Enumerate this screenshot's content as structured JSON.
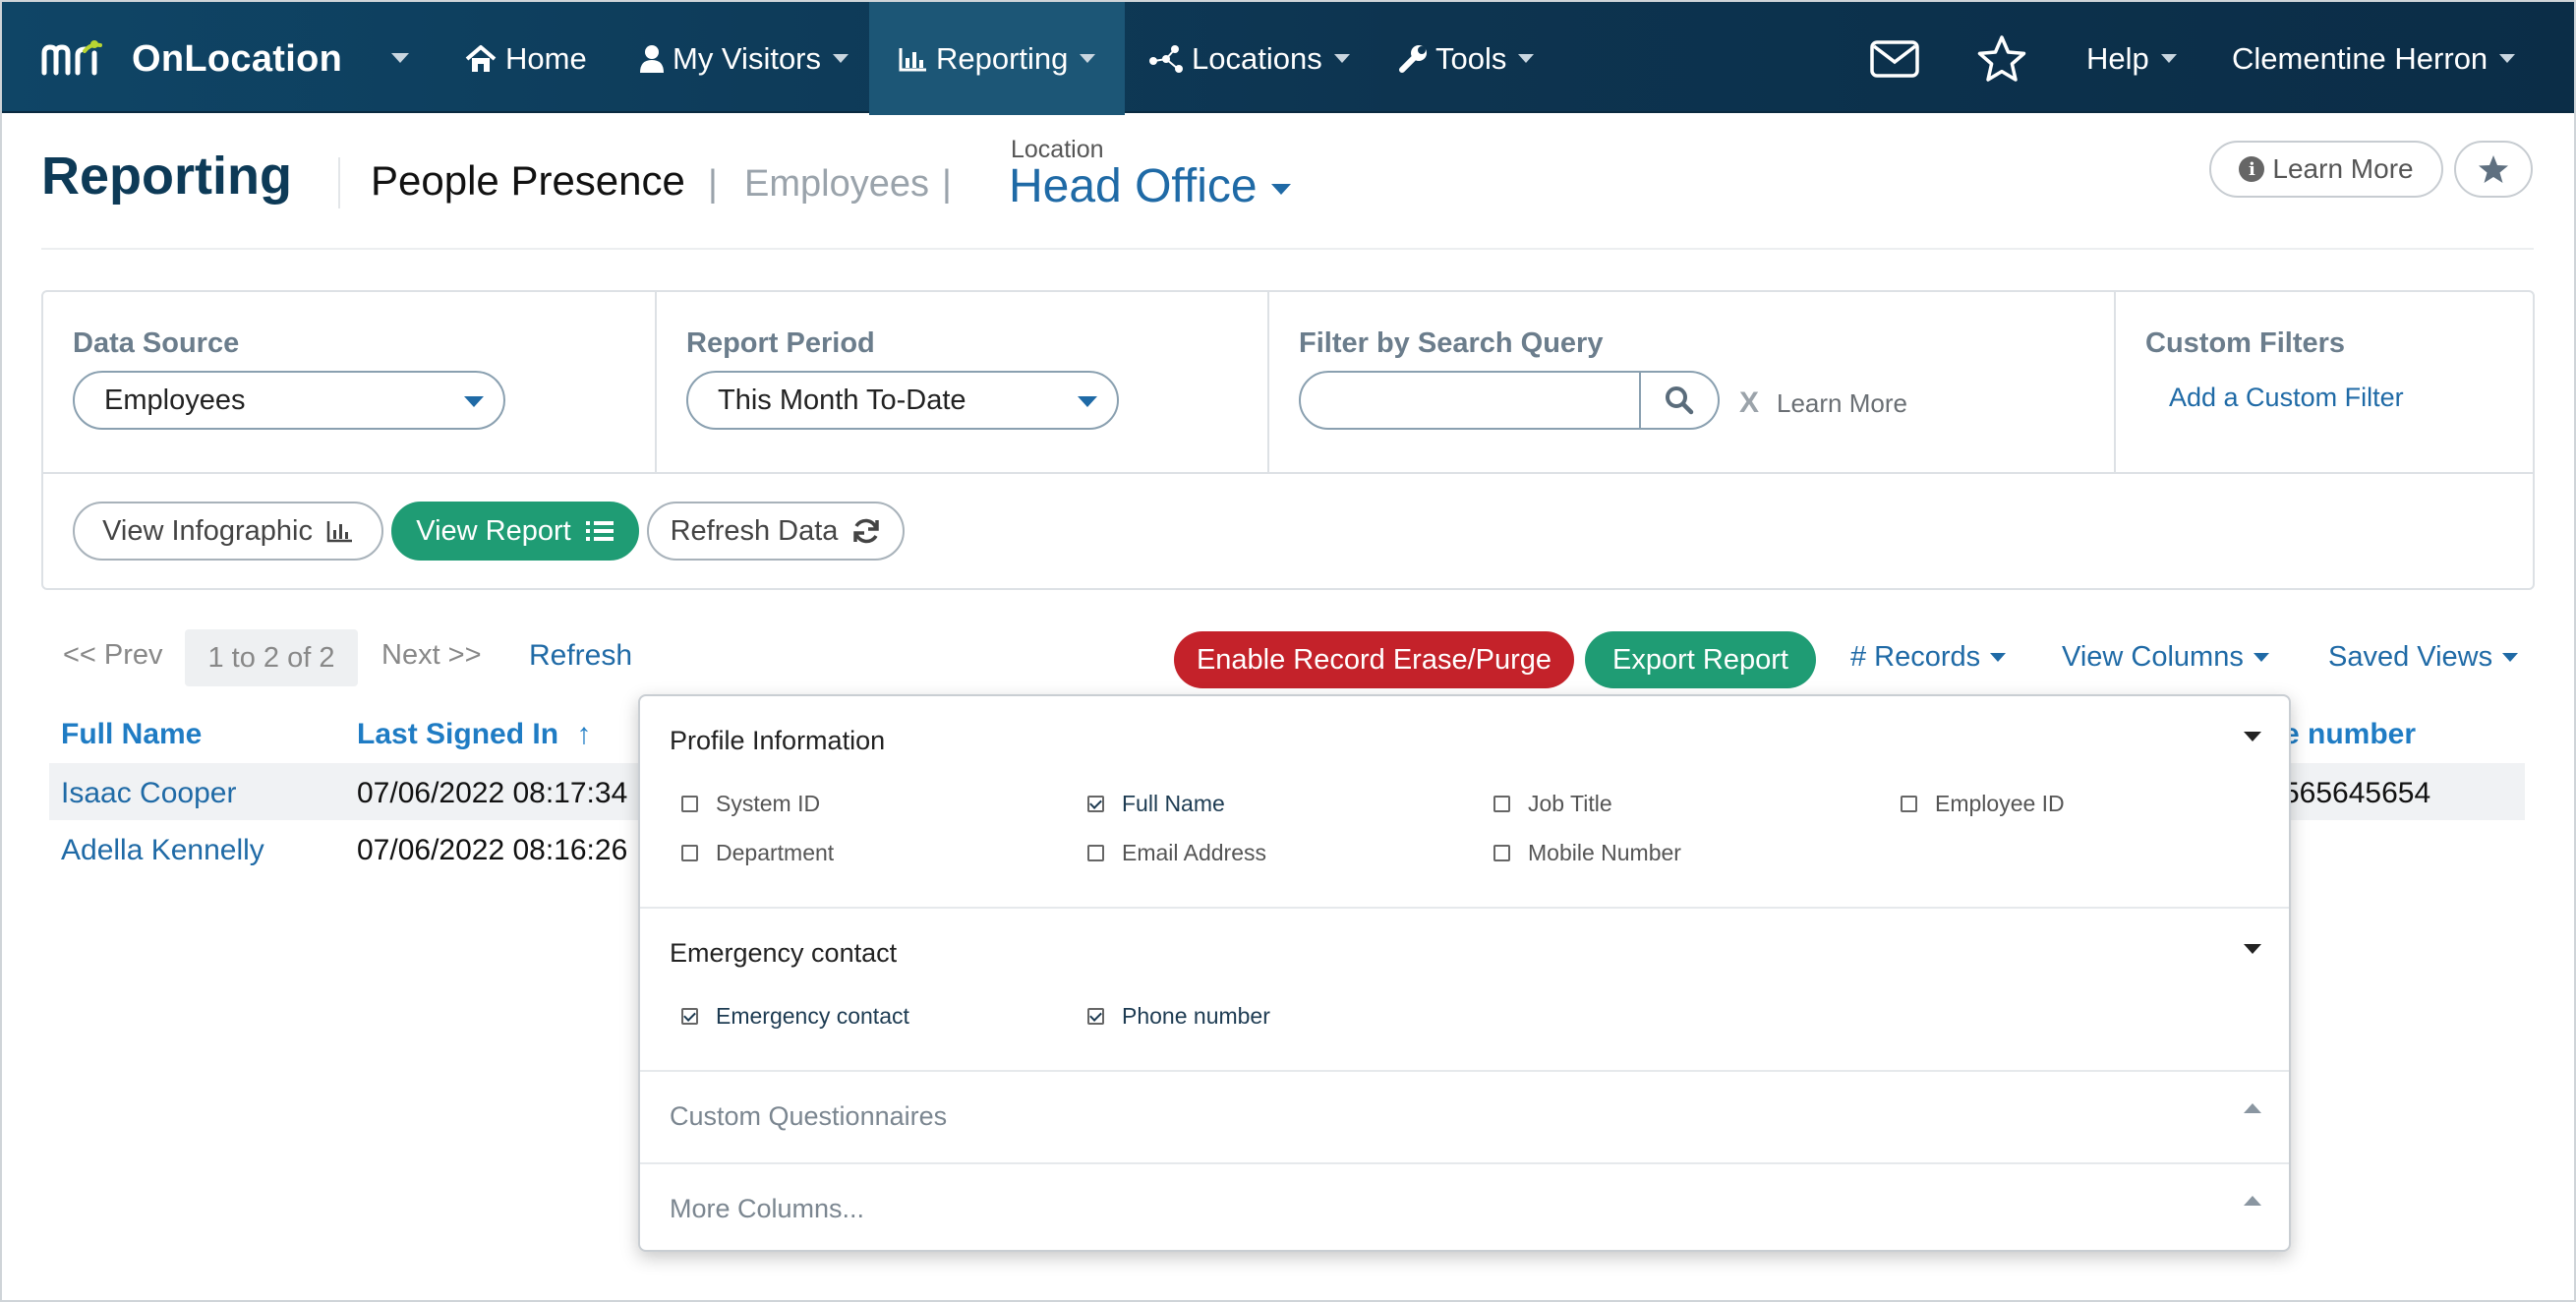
{
  "nav": {
    "brand_mark": "mri",
    "brand_name": "OnLocation",
    "items": [
      {
        "label": "Home",
        "icon": "home-icon"
      },
      {
        "label": "My Visitors",
        "icon": "user-icon"
      },
      {
        "label": "Reporting",
        "icon": "bar-chart-icon"
      },
      {
        "label": "Locations",
        "icon": "network-icon"
      },
      {
        "label": "Tools",
        "icon": "wrench-icon"
      }
    ],
    "help": "Help",
    "user": "Clementine Herron",
    "mail_icon": "envelope-icon",
    "star_icon": "star-icon"
  },
  "header": {
    "title": "Reporting",
    "subtitle_active": "People Presence",
    "subtitle_other": "Employees",
    "separator": "|",
    "location_label": "Location",
    "location_value": "Head Office",
    "learn_more": "Learn More"
  },
  "filters": {
    "data_source": {
      "label": "Data Source",
      "value": "Employees"
    },
    "report_period": {
      "label": "Report Period",
      "value": "This Month To-Date"
    },
    "search": {
      "label": "Filter by Search Query",
      "value": "",
      "clear_label": "X",
      "learn_more": "Learn More"
    },
    "custom": {
      "label": "Custom Filters",
      "add_label": "Add a Custom Filter"
    },
    "buttons": {
      "infographic": "View Infographic",
      "report": "View Report",
      "refresh": "Refresh Data"
    }
  },
  "toolbar": {
    "prev": "<< Prev",
    "range": "1 to 2 of 2",
    "next": "Next >>",
    "refresh": "Refresh",
    "erase": "Enable Record Erase/Purge",
    "export": "Export Report",
    "records": "# Records",
    "view_columns": "View Columns",
    "saved_views": "Saved Views"
  },
  "table": {
    "headers": {
      "full_name": "Full Name",
      "last_signed_in": "Last Signed In",
      "sort_arrow": "↑",
      "phone_partial": "e number"
    },
    "rows": [
      {
        "name": "Isaac Cooper",
        "date": "07/06/2022 08:17:34",
        "phone_partial": "565645654"
      },
      {
        "name": "Adella Kennelly",
        "date": "07/06/2022 08:16:26",
        "phone_partial": ""
      }
    ]
  },
  "columns_menu": {
    "profile": {
      "title": "Profile Information",
      "options": [
        {
          "label": "System ID",
          "checked": false
        },
        {
          "label": "Full Name",
          "checked": true
        },
        {
          "label": "Job Title",
          "checked": false
        },
        {
          "label": "Employee ID",
          "checked": false
        },
        {
          "label": "Department",
          "checked": false
        },
        {
          "label": "Email Address",
          "checked": false
        },
        {
          "label": "Mobile Number",
          "checked": false
        }
      ]
    },
    "emergency": {
      "title": "Emergency contact",
      "options": [
        {
          "label": "Emergency contact",
          "checked": true
        },
        {
          "label": "Phone number",
          "checked": true
        }
      ]
    },
    "custom_questionnaires": "Custom Questionnaires",
    "more_columns": "More Columns..."
  },
  "colors": {
    "nav_bg": "#0d3450",
    "accent_blue": "#1f6aa6",
    "green": "#1f9c74",
    "red": "#c4222a",
    "title_navy": "#0d3a57"
  }
}
